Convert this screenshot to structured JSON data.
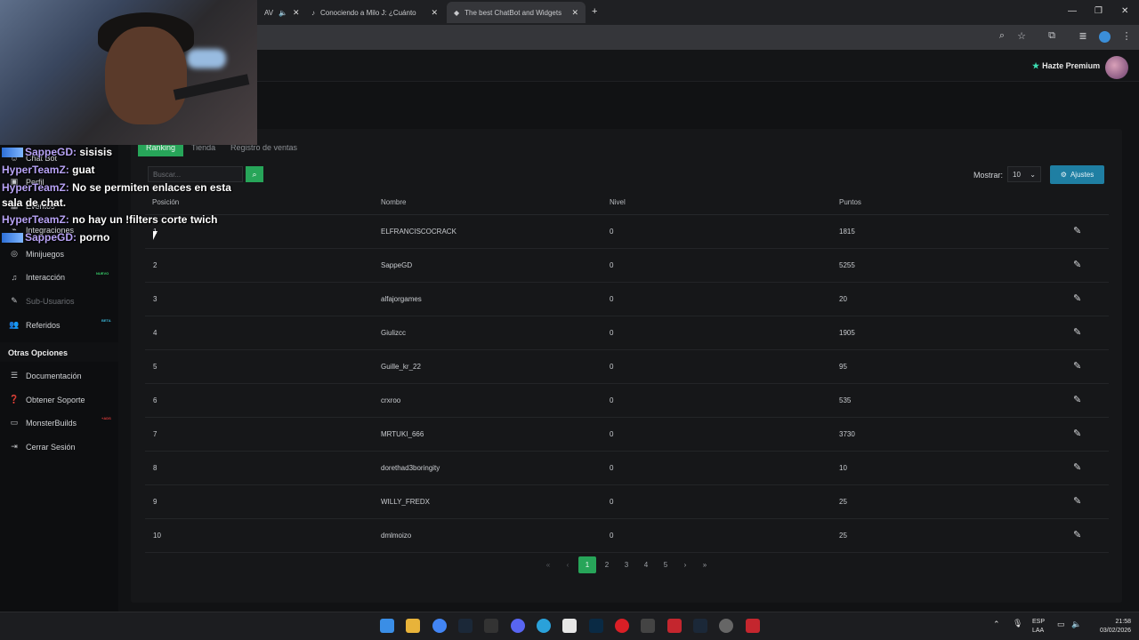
{
  "browser": {
    "tabs": [
      {
        "label": "AV"
      },
      {
        "label": "Conociendo a Milo J: ¿Cuánto"
      },
      {
        "label": "The best ChatBot and Widgets"
      }
    ]
  },
  "header": {
    "premium_label": "Hazte Premium"
  },
  "sidebar": {
    "items": [
      {
        "label": "Chat Bot"
      },
      {
        "label": "Perfil"
      },
      {
        "label": "Eventos"
      },
      {
        "label": "Integraciones"
      },
      {
        "label": "Minijuegos"
      },
      {
        "label": "Interacción",
        "badge": "NUEVO"
      },
      {
        "label": "Sub-Usuarios"
      },
      {
        "label": "Referidos",
        "badge": "BETA"
      }
    ],
    "section_title": "Otras Opciones",
    "other_items": [
      {
        "label": "Documentación"
      },
      {
        "label": "Obtener Soporte"
      },
      {
        "label": "MonsterBuilds",
        "badge": "+ADS"
      },
      {
        "label": "Cerrar Sesión"
      }
    ]
  },
  "panel": {
    "tabs": [
      {
        "label": "Ranking"
      },
      {
        "label": "Tienda"
      },
      {
        "label": "Registro de ventas"
      }
    ],
    "search_placeholder": "Buscar...",
    "show_label": "Mostrar:",
    "show_value": "10",
    "settings_label": "Ajustes",
    "columns": [
      "Posición",
      "Nombre",
      "Nivel",
      "Puntos"
    ],
    "rows": [
      {
        "pos": "1",
        "name": "ELFRANCISCOCRACK",
        "level": "0",
        "points": "1815"
      },
      {
        "pos": "2",
        "name": "SappeGD",
        "level": "0",
        "points": "5255"
      },
      {
        "pos": "3",
        "name": "alfajorgames",
        "level": "0",
        "points": "20"
      },
      {
        "pos": "4",
        "name": "Giulizcc",
        "level": "0",
        "points": "1905"
      },
      {
        "pos": "5",
        "name": "Guille_kr_22",
        "level": "0",
        "points": "95"
      },
      {
        "pos": "6",
        "name": "crxroo",
        "level": "0",
        "points": "535"
      },
      {
        "pos": "7",
        "name": "MRTUKI_666",
        "level": "0",
        "points": "3730"
      },
      {
        "pos": "8",
        "name": "dorethad3boringity",
        "level": "0",
        "points": "10"
      },
      {
        "pos": "9",
        "name": "WILLY_FREDX",
        "level": "0",
        "points": "25"
      },
      {
        "pos": "10",
        "name": "dmlmoizo",
        "level": "0",
        "points": "25"
      }
    ],
    "pages": [
      "1",
      "2",
      "3",
      "4",
      "5"
    ]
  },
  "chat": [
    {
      "user": "SappeGD:",
      "msg": " sisisis",
      "icon": true
    },
    {
      "user": "HyperTeamZ:",
      "msg": " guat",
      "icon": false
    },
    {
      "user": "HyperTeamZ:",
      "msg": " No se permiten enlaces en esta",
      "icon": false
    },
    {
      "user": "",
      "msg": "sala de chat.",
      "icon": false
    },
    {
      "user": "HyperTeamZ:",
      "msg": " no hay un !filters corte twich",
      "icon": false
    },
    {
      "user": "SappeGD:",
      "msg": " porno",
      "icon": true
    }
  ],
  "taskbar": {
    "lang1": "ESP",
    "lang2": "LAA",
    "time": "21:58",
    "date": "03/02/2026"
  }
}
